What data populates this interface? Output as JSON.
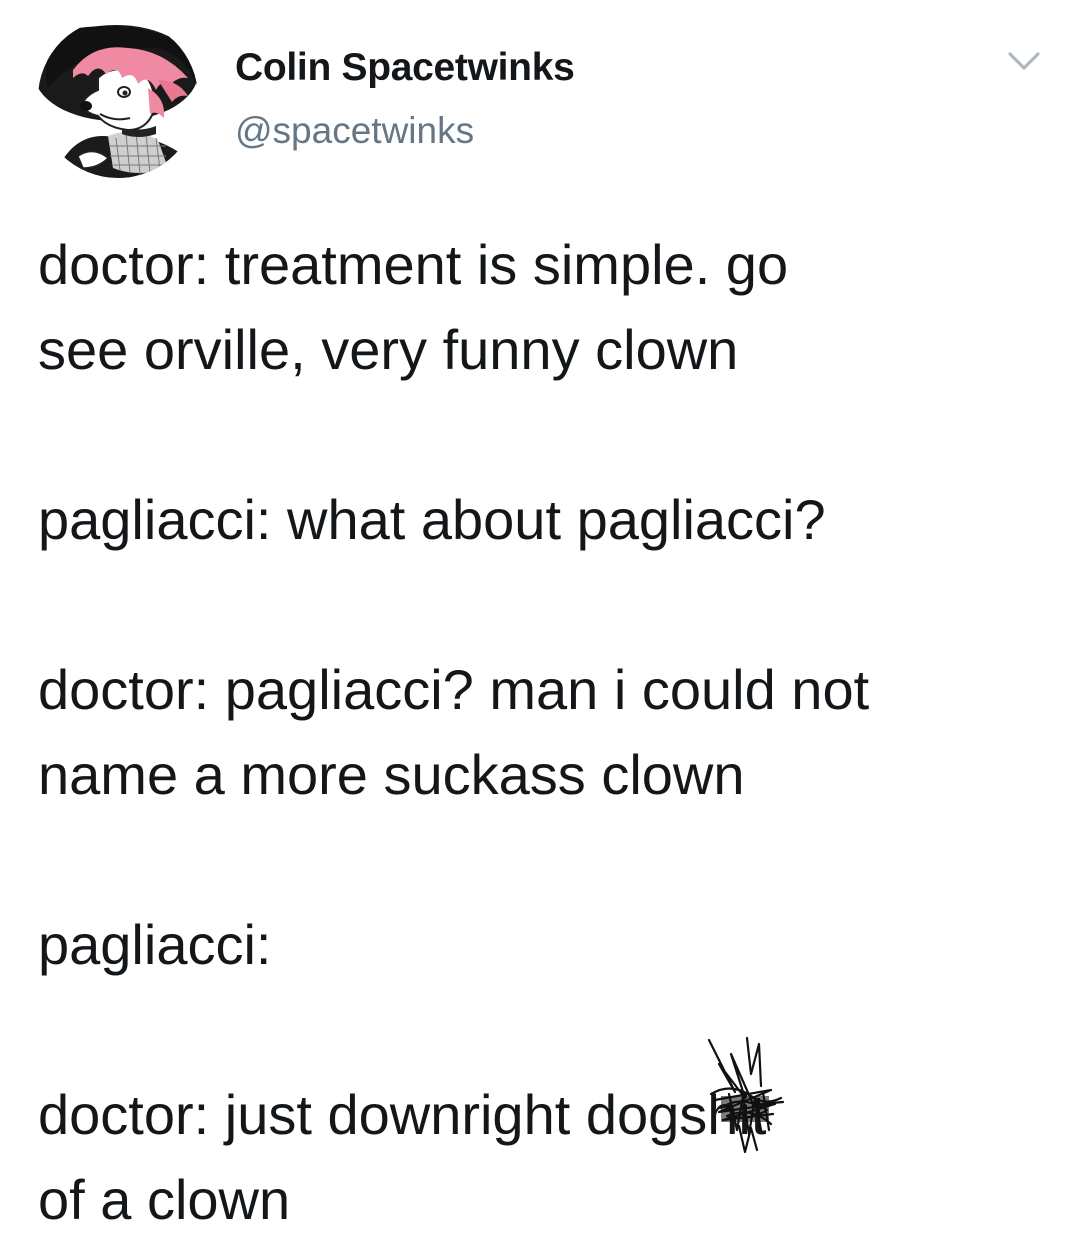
{
  "author": {
    "display_name": "Colin Spacetwinks",
    "handle": "@spacetwinks",
    "avatar_icon": "avatar-image"
  },
  "header": {
    "menu_icon": "chevron-down-icon"
  },
  "tweet": {
    "paragraphs": [
      "doctor: treatment is simple. go\nsee orville, very funny clown",
      "pagliacci: what about pagliacci?",
      "doctor: pagliacci? man i could not\nname a more suckass clown",
      "pagliacci:"
    ],
    "last_line_before": "doctor: just downright dogs",
    "last_line_censored": "hit",
    "last_line_after": "of a clown"
  },
  "colors": {
    "text": "#14171a",
    "secondary": "#657786",
    "caret": "#aab8c2"
  }
}
